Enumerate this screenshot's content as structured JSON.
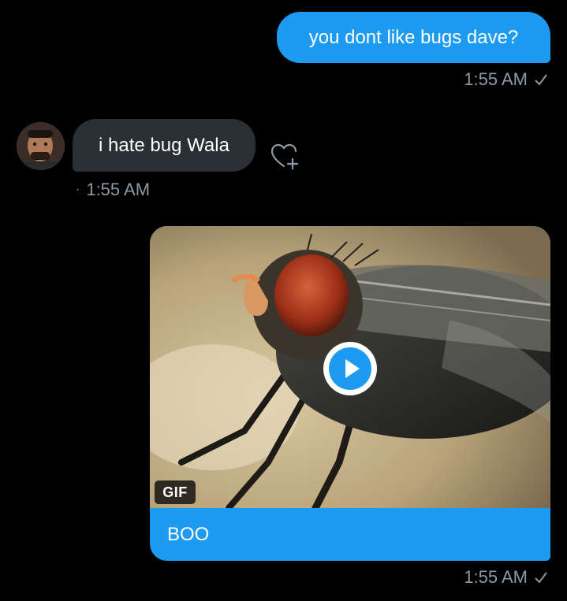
{
  "messages": [
    {
      "direction": "outgoing",
      "text": "you dont like bugs dave?",
      "time": "1:55 AM",
      "status_icon": "check-icon"
    },
    {
      "direction": "incoming",
      "text": "i hate bug Wala",
      "time": "1:55 AM",
      "time_prefix": "·",
      "reaction_icon": "heart-add-icon",
      "avatar_icon": "avatar"
    },
    {
      "direction": "outgoing",
      "media_type": "gif",
      "media_badge": "GIF",
      "media_subject": "fly",
      "play_icon": "play-icon",
      "caption": "BOO",
      "time": "1:55 AM",
      "status_icon": "check-icon"
    }
  ],
  "colors": {
    "background": "#000000",
    "outgoing_bubble": "#1d9bf0",
    "incoming_bubble": "#2a2f34",
    "meta_text": "#8b9aa6",
    "play_accent": "#1d9bf0"
  }
}
